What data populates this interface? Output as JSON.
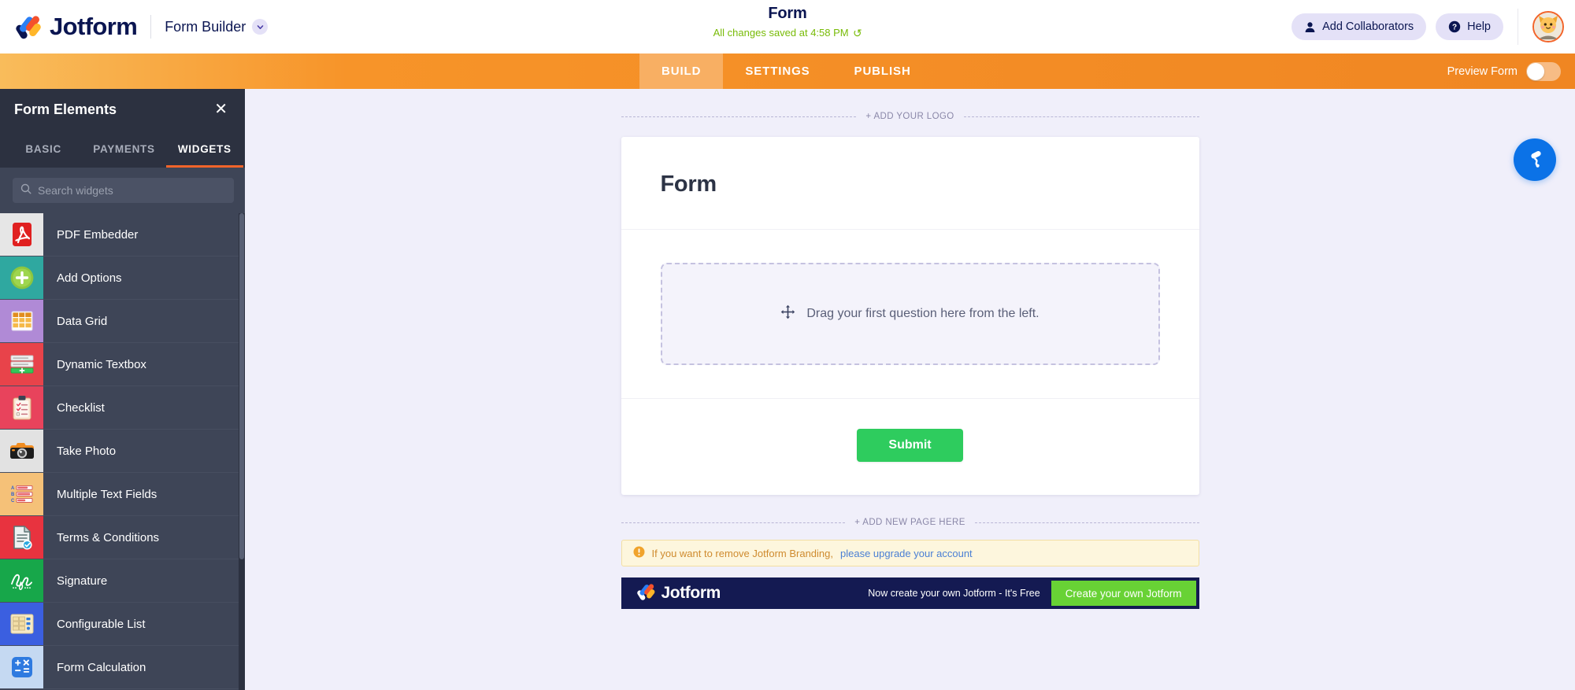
{
  "header": {
    "brand_name": "Jotform",
    "product_label": "Form Builder",
    "form_title": "Form",
    "save_status": "All changes saved at 4:58 PM",
    "save_refresh_glyph": "↻",
    "add_collaborators_label": "Add Collaborators",
    "help_label": "Help"
  },
  "nav": {
    "tabs": [
      {
        "label": "BUILD",
        "active": true
      },
      {
        "label": "SETTINGS",
        "active": false
      },
      {
        "label": "PUBLISH",
        "active": false
      }
    ],
    "preview_label": "Preview Form",
    "preview_enabled": false
  },
  "sidebar": {
    "title": "Form Elements",
    "close_glyph": "✕",
    "tabs": [
      {
        "label": "BASIC",
        "active": false
      },
      {
        "label": "PAYMENTS",
        "active": false
      },
      {
        "label": "WIDGETS",
        "active": true
      }
    ],
    "search_placeholder": "Search widgets",
    "search_value": "",
    "widgets": [
      {
        "label": "Form Calculation",
        "icon": "calculator-icon",
        "bg": "#c5d9f2"
      },
      {
        "label": "Configurable List",
        "icon": "list-grid-icon",
        "bg": "#3b5fe0"
      },
      {
        "label": "Signature",
        "icon": "signature-icon",
        "bg": "#17a74a"
      },
      {
        "label": "Terms & Conditions",
        "icon": "document-check-icon",
        "bg": "#e8333f"
      },
      {
        "label": "Multiple Text Fields",
        "icon": "text-fields-icon",
        "bg": "#f5c178"
      },
      {
        "label": "Take Photo",
        "icon": "camera-icon",
        "bg": "#e2e2e2"
      },
      {
        "label": "Checklist",
        "icon": "clipboard-check-icon",
        "bg": "#e8435c"
      },
      {
        "label": "Dynamic Textbox",
        "icon": "textbox-rows-icon",
        "bg": "#e8434a"
      },
      {
        "label": "Data Grid",
        "icon": "data-grid-icon",
        "bg": "#b08ad6"
      },
      {
        "label": "Add Options",
        "icon": "plus-circle-icon",
        "bg": "#2fa8a0"
      },
      {
        "label": "PDF Embedder",
        "icon": "pdf-icon",
        "bg": "#e6e6e6"
      }
    ]
  },
  "canvas": {
    "add_logo_label": "+ ADD YOUR LOGO",
    "form_heading": "Form",
    "dropzone_text": "Drag your first question here from the left.",
    "submit_label": "Submit",
    "add_page_label": "+ ADD NEW PAGE HERE",
    "branding_text": "If you want to remove Jotform Branding,",
    "branding_link": "please upgrade your account",
    "banner_brand": "Jotform",
    "banner_text": "Now create your own Jotform - It's Free",
    "banner_button": "Create your own Jotform"
  },
  "colors": {
    "accent_orange": "#f2642a",
    "submit_green": "#2ecc5e",
    "banner_navy": "#141a52",
    "banner_green": "#68d235",
    "sidebar_bg": "#3e4557",
    "canvas_bg": "#f0effa",
    "save_green": "#78bb07",
    "fab_blue": "#0b72e7"
  }
}
